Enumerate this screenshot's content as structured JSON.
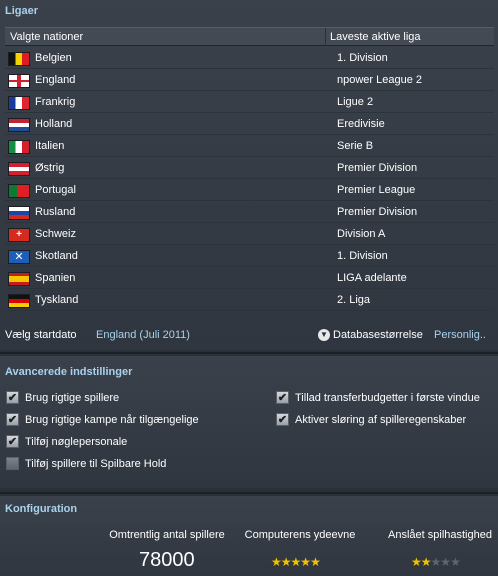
{
  "leagues": {
    "title": "Ligaer",
    "col_nation": "Valgte nationer",
    "col_league": "Laveste aktive liga",
    "rows": [
      {
        "nation": "Belgien",
        "league": "1. Division",
        "flag": "belgium-flag"
      },
      {
        "nation": "England",
        "league": "npower League 2",
        "flag": "england-flag"
      },
      {
        "nation": "Frankrig",
        "league": "Ligue 2",
        "flag": "france-flag"
      },
      {
        "nation": "Holland",
        "league": "Eredivisie",
        "flag": "netherlands-flag"
      },
      {
        "nation": "Italien",
        "league": "Serie B",
        "flag": "italy-flag"
      },
      {
        "nation": "Østrig",
        "league": "Premier Division",
        "flag": "austria-flag"
      },
      {
        "nation": "Portugal",
        "league": "Premier League",
        "flag": "portugal-flag"
      },
      {
        "nation": "Rusland",
        "league": "Premier Division",
        "flag": "russia-flag"
      },
      {
        "nation": "Schweiz",
        "league": "Division A",
        "flag": "switzerland-flag"
      },
      {
        "nation": "Skotland",
        "league": "1. Division",
        "flag": "scotland-flag"
      },
      {
        "nation": "Spanien",
        "league": "LIGA adelante",
        "flag": "spain-flag"
      },
      {
        "nation": "Tyskland",
        "league": "2. Liga",
        "flag": "germany-flag"
      }
    ],
    "start_label": "Vælg startdato",
    "start_value": "England (Juli 2011)",
    "db_label": "Databasestørrelse",
    "db_value": "Personlig..",
    "db_icon": "chevron-down-icon"
  },
  "advanced": {
    "title": "Avancerede indstillinger",
    "checkboxes": [
      {
        "label": "Brug rigtige spillere",
        "checked": true
      },
      {
        "label": "Tillad transferbudgetter i første vindue",
        "checked": true
      },
      {
        "label": "Brug rigtige kampe når tilgængelige",
        "checked": true
      },
      {
        "label": "Aktiver sløring af spilleregenskaber",
        "checked": true
      },
      {
        "label": "Tilføj nøglepersonale",
        "checked": true
      },
      {
        "label": "Tilføj spillere til Spilbare Hold",
        "checked": false
      }
    ]
  },
  "config": {
    "title": "Konfiguration",
    "players_label": "Omtrentlig antal spillere",
    "players_value": "78000",
    "computer_label": "Computerens ydeevne",
    "computer_stars": 5,
    "speed_label": "Anslået spilhastighed",
    "speed_stars": 2,
    "stars_max": 5
  },
  "colors": {
    "accent": "#a9d2ec",
    "star": "#f2c200",
    "background": "#2a3038"
  }
}
